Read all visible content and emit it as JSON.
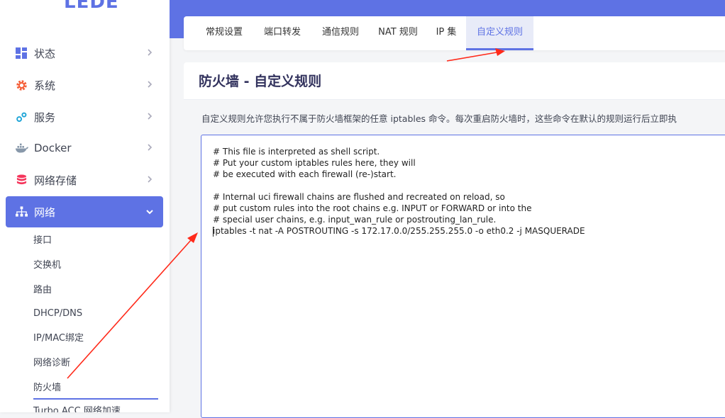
{
  "brand": {
    "logo": "LEDE"
  },
  "sidebar": {
    "items": [
      {
        "label": "状态",
        "icon": "dashboard-icon"
      },
      {
        "label": "系统",
        "icon": "gear-icon"
      },
      {
        "label": "服务",
        "icon": "services-icon"
      },
      {
        "label": "Docker",
        "icon": "docker-icon"
      },
      {
        "label": "网络存储",
        "icon": "database-icon"
      },
      {
        "label": "网络",
        "icon": "network-icon",
        "expanded": true
      }
    ],
    "sub_items": [
      "接口",
      "交换机",
      "路由",
      "DHCP/DNS",
      "IP/MAC绑定",
      "网络诊断",
      "防火墙",
      "Turbo ACC 网络加速"
    ],
    "active_sub": "防火墙"
  },
  "tabs": [
    "常规设置",
    "端口转发",
    "通信规则",
    "NAT 规则",
    "IP 集",
    "自定义规则"
  ],
  "active_tab": "自定义规则",
  "page": {
    "title": "防火墙 - 自定义规则",
    "description": "自定义规则允许您执行不属于防火墙框架的任意 iptables 命令。每次重启防火墙时，这些命令在默认的规则运行后立即执"
  },
  "editor": {
    "lines": [
      "# This file is interpreted as shell script.",
      "# Put your custom iptables rules here, they will",
      "# be executed with each firewall (re-)start.",
      "",
      "# Internal uci firewall chains are flushed and recreated on reload, so",
      "# put custom rules into the root chains e.g. INPUT or FORWARD or into the",
      "# special user chains, e.g. input_wan_rule or postrouting_lan_rule.",
      "iptables -t nat -A POSTROUTING -s 172.17.0.0/255.255.255.0 -o eth0.2 -j MASQUERADE"
    ]
  },
  "colors": {
    "accent": "#5e72e4",
    "annotation": "#ff2a1a"
  }
}
